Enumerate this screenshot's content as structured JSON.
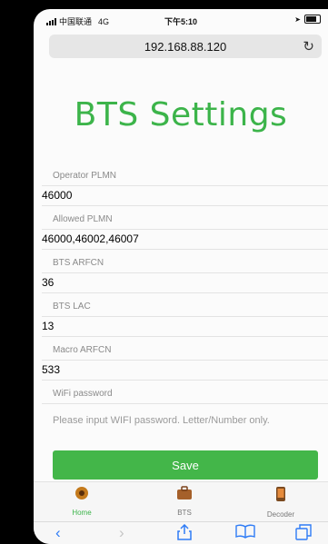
{
  "status_bar": {
    "carrier": "中国联通",
    "network": "4G",
    "time": "下午5:10"
  },
  "browser": {
    "url": "192.168.88.120"
  },
  "page": {
    "title": "BTS Settings"
  },
  "fields": {
    "operator_plmn": {
      "label": "Operator PLMN",
      "value": "46000"
    },
    "allowed_plmn": {
      "label": "Allowed PLMN",
      "value": "46000,46002,46007"
    },
    "bts_arfcn": {
      "label": "BTS ARFCN",
      "value": "36"
    },
    "bts_lac": {
      "label": "BTS LAC",
      "value": "13"
    },
    "macro_arfcn": {
      "label": "Macro ARFCN",
      "value": "533"
    },
    "wifi_password": {
      "label": "WiFi password",
      "placeholder": "Please input WIFI password. Letter/Number only."
    }
  },
  "save_label": "Save",
  "tabs": [
    {
      "label": "Home",
      "icon": "home-icon",
      "active": true
    },
    {
      "label": "BTS",
      "icon": "briefcase-icon",
      "active": false
    },
    {
      "label": "Decoder",
      "icon": "phone-icon",
      "active": false
    }
  ],
  "colors": {
    "accent": "#3cb44a",
    "button": "#43b649"
  }
}
